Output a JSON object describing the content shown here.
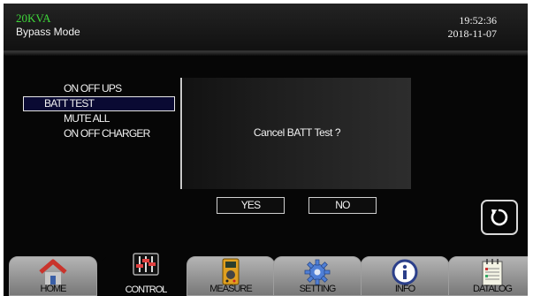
{
  "header": {
    "capacity": "20KVA",
    "mode": "Bypass Mode",
    "time": "19:52:36",
    "date": "2018-11-07"
  },
  "menu": {
    "items": [
      {
        "label": "ON OFF UPS",
        "selected": false
      },
      {
        "label": "BATT TEST",
        "selected": true
      },
      {
        "label": "MUTE ALL",
        "selected": false
      },
      {
        "label": "ON OFF CHARGER",
        "selected": false
      }
    ]
  },
  "dialog": {
    "message": "Cancel  BATT Test ?",
    "yes_label": "YES",
    "no_label": "NO"
  },
  "back_icon": "refresh-icon",
  "nav": {
    "items": [
      {
        "label": "HOME",
        "icon": "home-icon"
      },
      {
        "label": "CONTROL",
        "icon": "sliders-icon"
      },
      {
        "label": "MEASURE",
        "icon": "multimeter-icon"
      },
      {
        "label": "SETTING",
        "icon": "gear-icon"
      },
      {
        "label": "INFO",
        "icon": "info-icon"
      },
      {
        "label": "DATALOG",
        "icon": "notepad-icon"
      }
    ]
  },
  "colors": {
    "capacity_text": "#3fd93a",
    "background": "#060606",
    "nav_button": "#a0a0a0",
    "selected_row": "#0a0a33"
  }
}
